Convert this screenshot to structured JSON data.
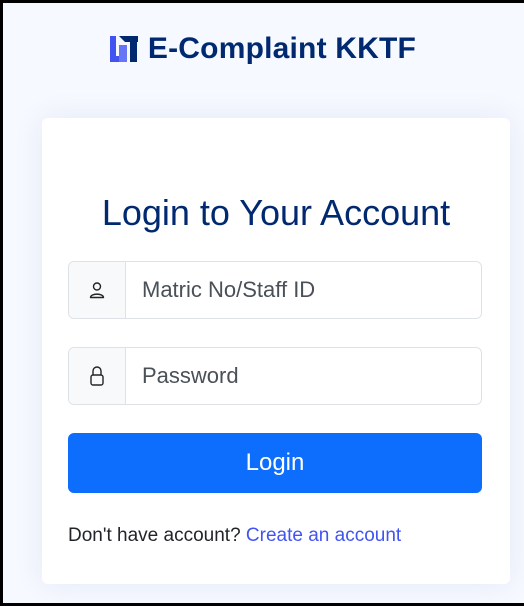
{
  "brand": {
    "name": "E-Complaint KKTF",
    "logo_icon": "brand-logo-icon"
  },
  "login": {
    "title": "Login to Your Account",
    "username": {
      "icon": "person-icon",
      "placeholder": "Matric No/Staff ID",
      "value": ""
    },
    "password": {
      "icon": "lock-icon",
      "placeholder": "Password",
      "value": ""
    },
    "submit_label": "Login",
    "signup_prompt": "Don't have account? ",
    "signup_link": "Create an account"
  },
  "colors": {
    "brand_text": "#012970",
    "primary_button": "#0d6efd",
    "link": "#4154f1",
    "background": "#f6f9ff"
  }
}
